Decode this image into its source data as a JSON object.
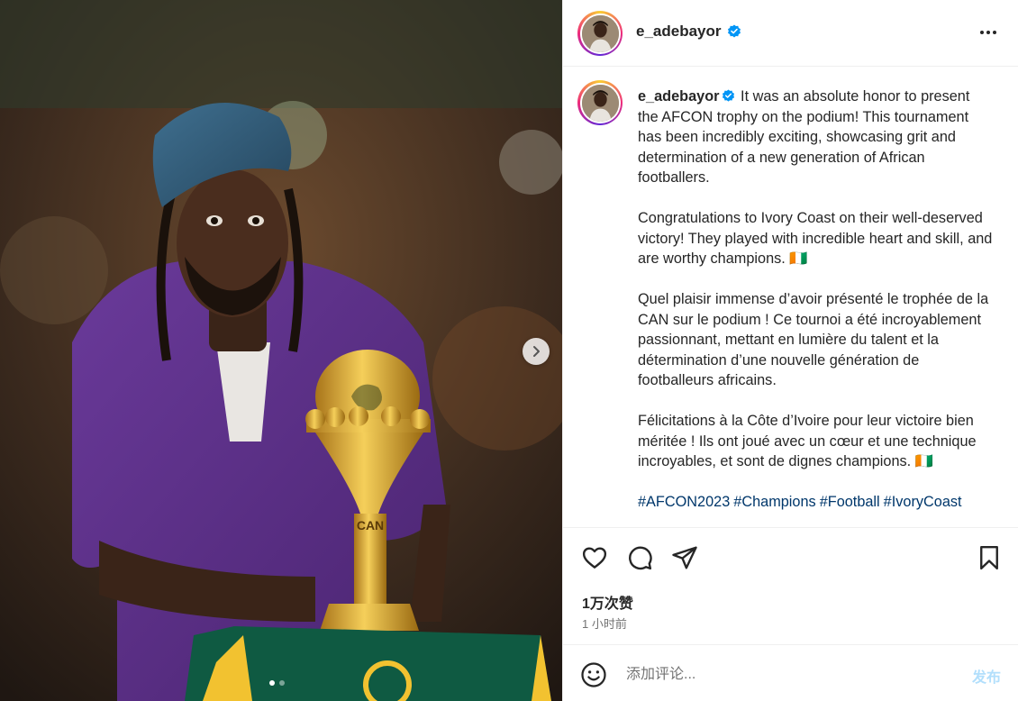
{
  "media": {
    "description_icon": "photo",
    "next_icon": "chevron-right-icon",
    "carousel": {
      "count": 2,
      "active_index": 0
    },
    "trophy_label": "CAN"
  },
  "header": {
    "username": "e_adebayor",
    "verified_icon": "verified-badge-icon",
    "more_icon": "more-horizontal-icon"
  },
  "caption": {
    "username": "e_adebayor",
    "para1": "It was an absolute honor to present the AFCON trophy on the podium! This tournament has been incredibly exciting, showcasing grit and determination of a new generation of African footballers.",
    "para2": "Congratulations to Ivory Coast on their well-deserved victory! They played with incredible heart and skill, and are worthy champions. 🇨🇮",
    "para3": "Quel plaisir immense d’avoir présenté le trophée de la CAN sur le podium ! Ce tournoi a été incroyablement passionnant, mettant en lumière du talent et la détermination d’une nouvelle génération de footballeurs africains.",
    "para4": "Félicitations à la Côte d’Ivoire pour leur victoire bien méritée ! Ils ont joué avec un cœur et une technique incroyables, et sont de dignes champions. 🇨🇮",
    "hashtags": [
      "#AFCON2023",
      "#Champions",
      "#Football",
      "#IvoryCoast"
    ]
  },
  "actions": {
    "like_icon": "heart-icon",
    "comment_icon": "comment-bubble-icon",
    "share_icon": "paper-plane-icon",
    "save_icon": "bookmark-icon",
    "likes": "1万次赞",
    "time": "1 小时前"
  },
  "comment": {
    "emoji_icon": "smiley-face-icon",
    "placeholder": "添加评论...",
    "post_label": "发布"
  },
  "colors": {
    "text": "#262626",
    "secondary": "#737373",
    "hashtag": "#00376b",
    "verified": "#0095f6",
    "post_disabled": "#b2dffc"
  }
}
